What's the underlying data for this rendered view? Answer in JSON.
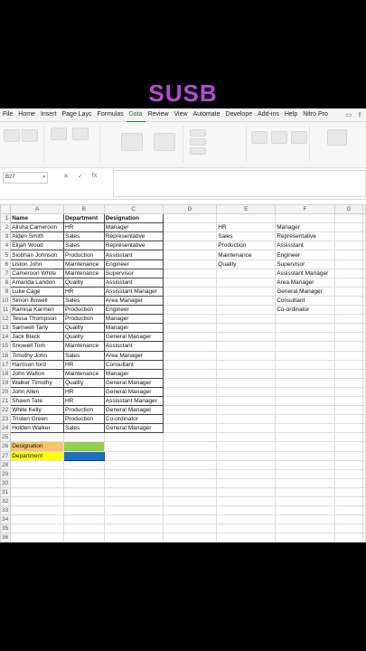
{
  "overlay": {
    "title": "SUSB",
    "color": "#b44bd6"
  },
  "menu": {
    "tabs": [
      "File",
      "Home",
      "Insert",
      "Page Layc",
      "Formulas",
      "Data",
      "Review",
      "View",
      "Automate",
      "Develope",
      "Add-ins",
      "Help",
      "Nitro Pro"
    ],
    "active": "Data"
  },
  "formula_bar": {
    "cell_ref": "B27",
    "fx": "fx"
  },
  "columns": [
    "A",
    "B",
    "C",
    "D",
    "E",
    "F",
    "G"
  ],
  "rows": [
    [
      "Name",
      "Department",
      "Designation",
      "",
      "",
      "",
      ""
    ],
    [
      "Alisha Cameroon",
      "HR",
      "Manager",
      "",
      "HR",
      "Manager",
      ""
    ],
    [
      "Aiden Smith",
      "Sales",
      "Representative",
      "",
      "Sales",
      "Representative",
      ""
    ],
    [
      "Elijah Wood",
      "Sales",
      "Representative",
      "",
      "Production",
      "Assisstant",
      ""
    ],
    [
      "Siobhan Johnson",
      "Production",
      "Assisstant",
      "",
      "Maintenance",
      "Engineer",
      ""
    ],
    [
      "Liston John",
      "Maintenance",
      "Engineer",
      "",
      "Quality",
      "Supervisor",
      ""
    ],
    [
      "Cameroon White",
      "Maintenance",
      "Supervisor",
      "",
      "",
      "Assisstant Manager",
      ""
    ],
    [
      "Amanda Landon",
      "Quality",
      "Assisstant",
      "",
      "",
      "Area Manager",
      ""
    ],
    [
      "Luke Cage",
      "HR",
      "Assisstant Manager",
      "",
      "",
      "General Manager",
      ""
    ],
    [
      "Simon Bowell",
      "Sales",
      "Area Manager",
      "",
      "",
      "Consultant",
      ""
    ],
    [
      "Ramisa Karmen",
      "Production",
      "Engineer",
      "",
      "",
      "Co-ordinator",
      ""
    ],
    [
      "Tessa Thompson",
      "Production",
      "Manager",
      "",
      "",
      "",
      ""
    ],
    [
      "Samwell Tarly",
      "Quality",
      "Manager",
      "",
      "",
      "",
      ""
    ],
    [
      "Jack Black",
      "Quality",
      "General Manager",
      "",
      "",
      "",
      ""
    ],
    [
      "Snowell Tom",
      "Maintenance",
      "Assisstant",
      "",
      "",
      "",
      ""
    ],
    [
      "Timothy John",
      "Sales",
      "Area Manager",
      "",
      "",
      "",
      ""
    ],
    [
      "Harrison ford",
      "HR",
      "Consultant",
      "",
      "",
      "",
      ""
    ],
    [
      "John Walton",
      "Maintenance",
      "Manager",
      "",
      "",
      "",
      ""
    ],
    [
      "Walker Timothy",
      "Quality",
      "General Manager",
      "",
      "",
      "",
      ""
    ],
    [
      "John Allen",
      "HR",
      "General Manager",
      "",
      "",
      "",
      ""
    ],
    [
      "Shawn Tate",
      "HR",
      "Assisstant Manager",
      "",
      "",
      "",
      ""
    ],
    [
      "White Kelly",
      "Production",
      "General Manager",
      "",
      "",
      "",
      ""
    ],
    [
      "Tristen Green",
      "Production",
      "Co-ordinator",
      "",
      "",
      "",
      ""
    ],
    [
      "Holden Walker",
      "Sales",
      "General Manager",
      "",
      "",
      "",
      ""
    ],
    [
      "",
      "",
      "",
      "",
      "",
      "",
      ""
    ],
    [
      "Designation",
      "",
      "",
      "",
      "",
      "",
      ""
    ],
    [
      "Department",
      "",
      "",
      "",
      "",
      "",
      ""
    ],
    [
      "",
      "",
      "",
      "",
      "",
      "",
      ""
    ],
    [
      "",
      "",
      "",
      "",
      "",
      "",
      ""
    ],
    [
      "",
      "",
      "",
      "",
      "",
      "",
      ""
    ],
    [
      "",
      "",
      "",
      "",
      "",
      "",
      ""
    ],
    [
      "",
      "",
      "",
      "",
      "",
      "",
      ""
    ],
    [
      "",
      "",
      "",
      "",
      "",
      "",
      ""
    ],
    [
      "",
      "",
      "",
      "",
      "",
      "",
      ""
    ],
    [
      "",
      "",
      "",
      "",
      "",
      "",
      ""
    ],
    [
      "",
      "",
      "",
      "",
      "",
      "",
      ""
    ]
  ]
}
